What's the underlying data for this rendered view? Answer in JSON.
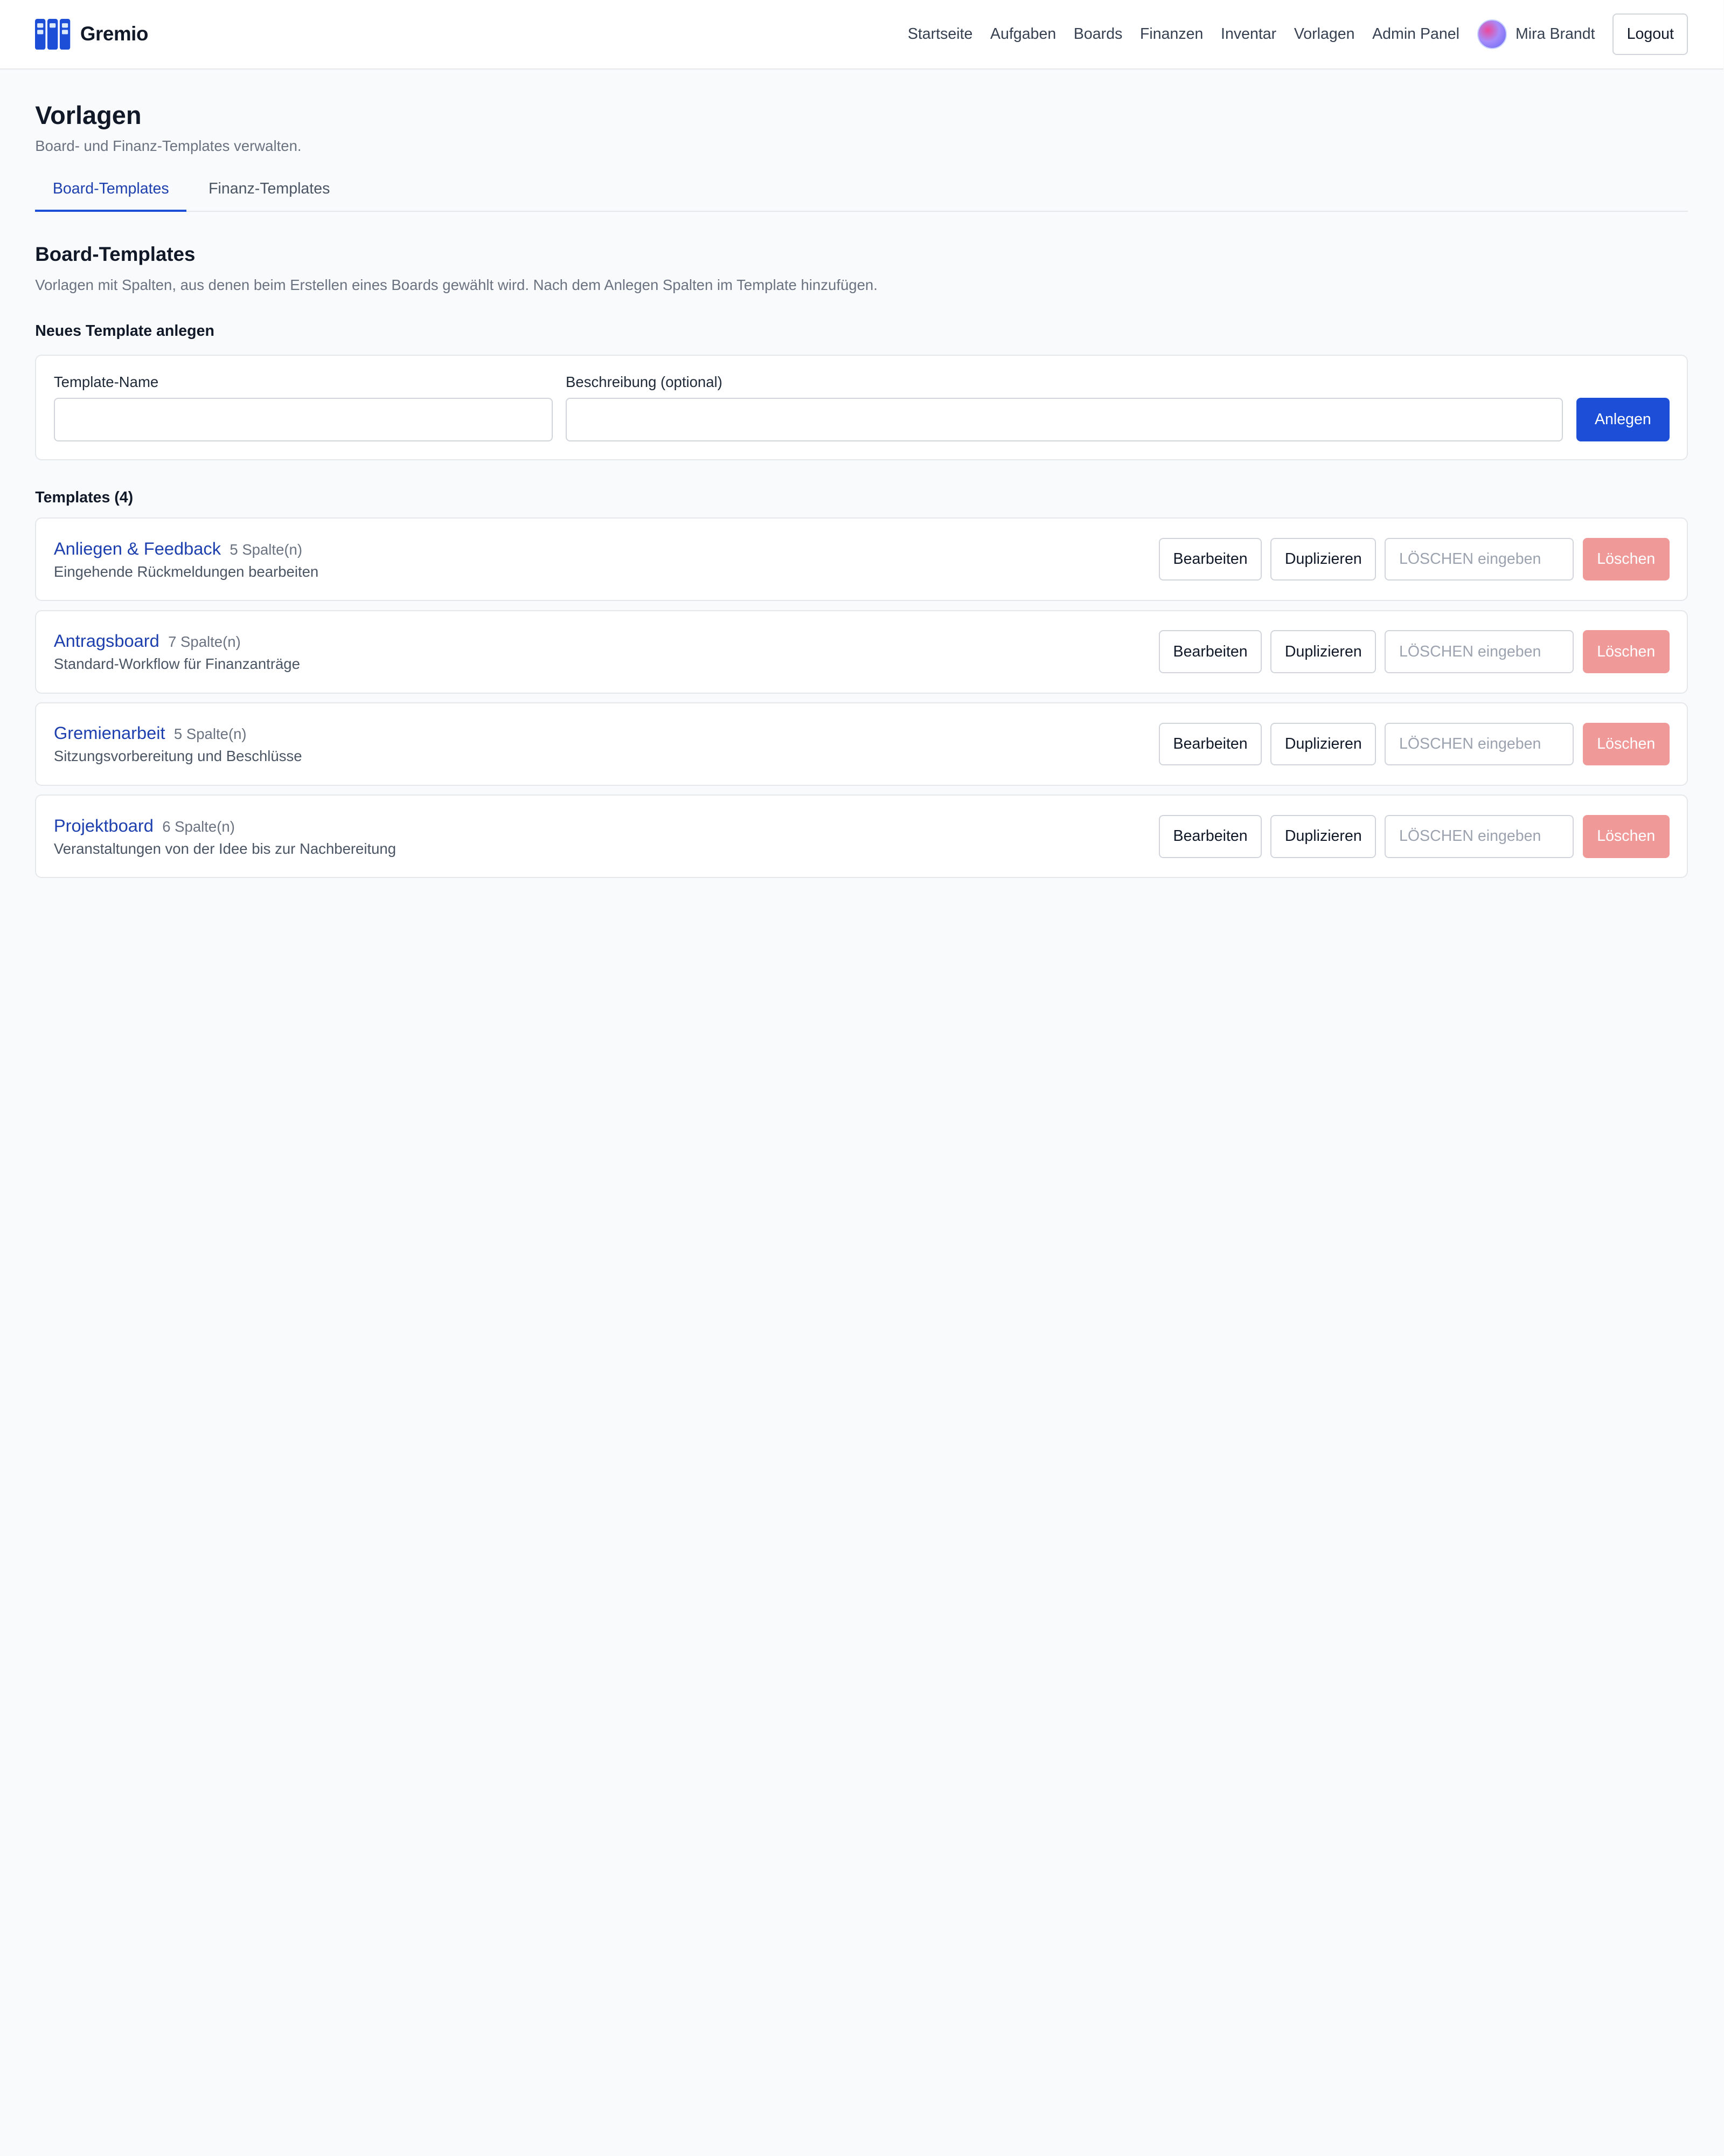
{
  "header": {
    "brand": "Gremio",
    "logo_icon": "board-columns-icon",
    "nav": [
      {
        "id": "startseite",
        "label": "Startseite"
      },
      {
        "id": "aufgaben",
        "label": "Aufgaben"
      },
      {
        "id": "boards",
        "label": "Boards"
      },
      {
        "id": "finanzen",
        "label": "Finanzen"
      },
      {
        "id": "inventar",
        "label": "Inventar"
      },
      {
        "id": "vorlagen",
        "label": "Vorlagen"
      },
      {
        "id": "admin-panel",
        "label": "Admin Panel"
      }
    ],
    "user_name": "Mira Brandt",
    "logout_label": "Logout"
  },
  "page": {
    "title": "Vorlagen",
    "subtitle": "Board- und Finanz-Templates verwalten."
  },
  "tabs": [
    {
      "id": "board-templates",
      "label": "Board-Templates",
      "active": true
    },
    {
      "id": "finanz-templates",
      "label": "Finanz-Templates",
      "active": false
    }
  ],
  "section": {
    "title": "Board-Templates",
    "description": "Vorlagen mit Spalten, aus denen beim Erstellen eines Boards gewählt wird. Nach dem Anlegen Spalten im Template hinzufügen."
  },
  "new_template": {
    "heading": "Neues Template anlegen",
    "name_label": "Template-Name",
    "name_value": "",
    "desc_label": "Beschreibung (optional)",
    "desc_value": "",
    "submit_label": "Anlegen"
  },
  "templates_heading": "Templates (4)",
  "actions": {
    "edit_label": "Bearbeiten",
    "duplicate_label": "Duplizieren",
    "confirm_placeholder": "LÖSCHEN eingeben",
    "delete_label": "Löschen"
  },
  "templates": [
    {
      "name": "Anliegen & Feedback",
      "columns": "5 Spalte(n)",
      "description": "Eingehende Rückmeldungen bearbeiten"
    },
    {
      "name": "Antragsboard",
      "columns": "7 Spalte(n)",
      "description": "Standard-Workflow für Finanzanträge"
    },
    {
      "name": "Gremienarbeit",
      "columns": "5 Spalte(n)",
      "description": "Sitzungsvorbereitung und Beschlüsse"
    },
    {
      "name": "Projektboard",
      "columns": "6 Spalte(n)",
      "description": "Veranstaltungen von der Idee bis zur Nachbereitung"
    }
  ],
  "colors": {
    "primary": "#1d4ed8",
    "link": "#1e40af",
    "danger_disabled": "#ef9999",
    "background": "#f9fafb"
  }
}
